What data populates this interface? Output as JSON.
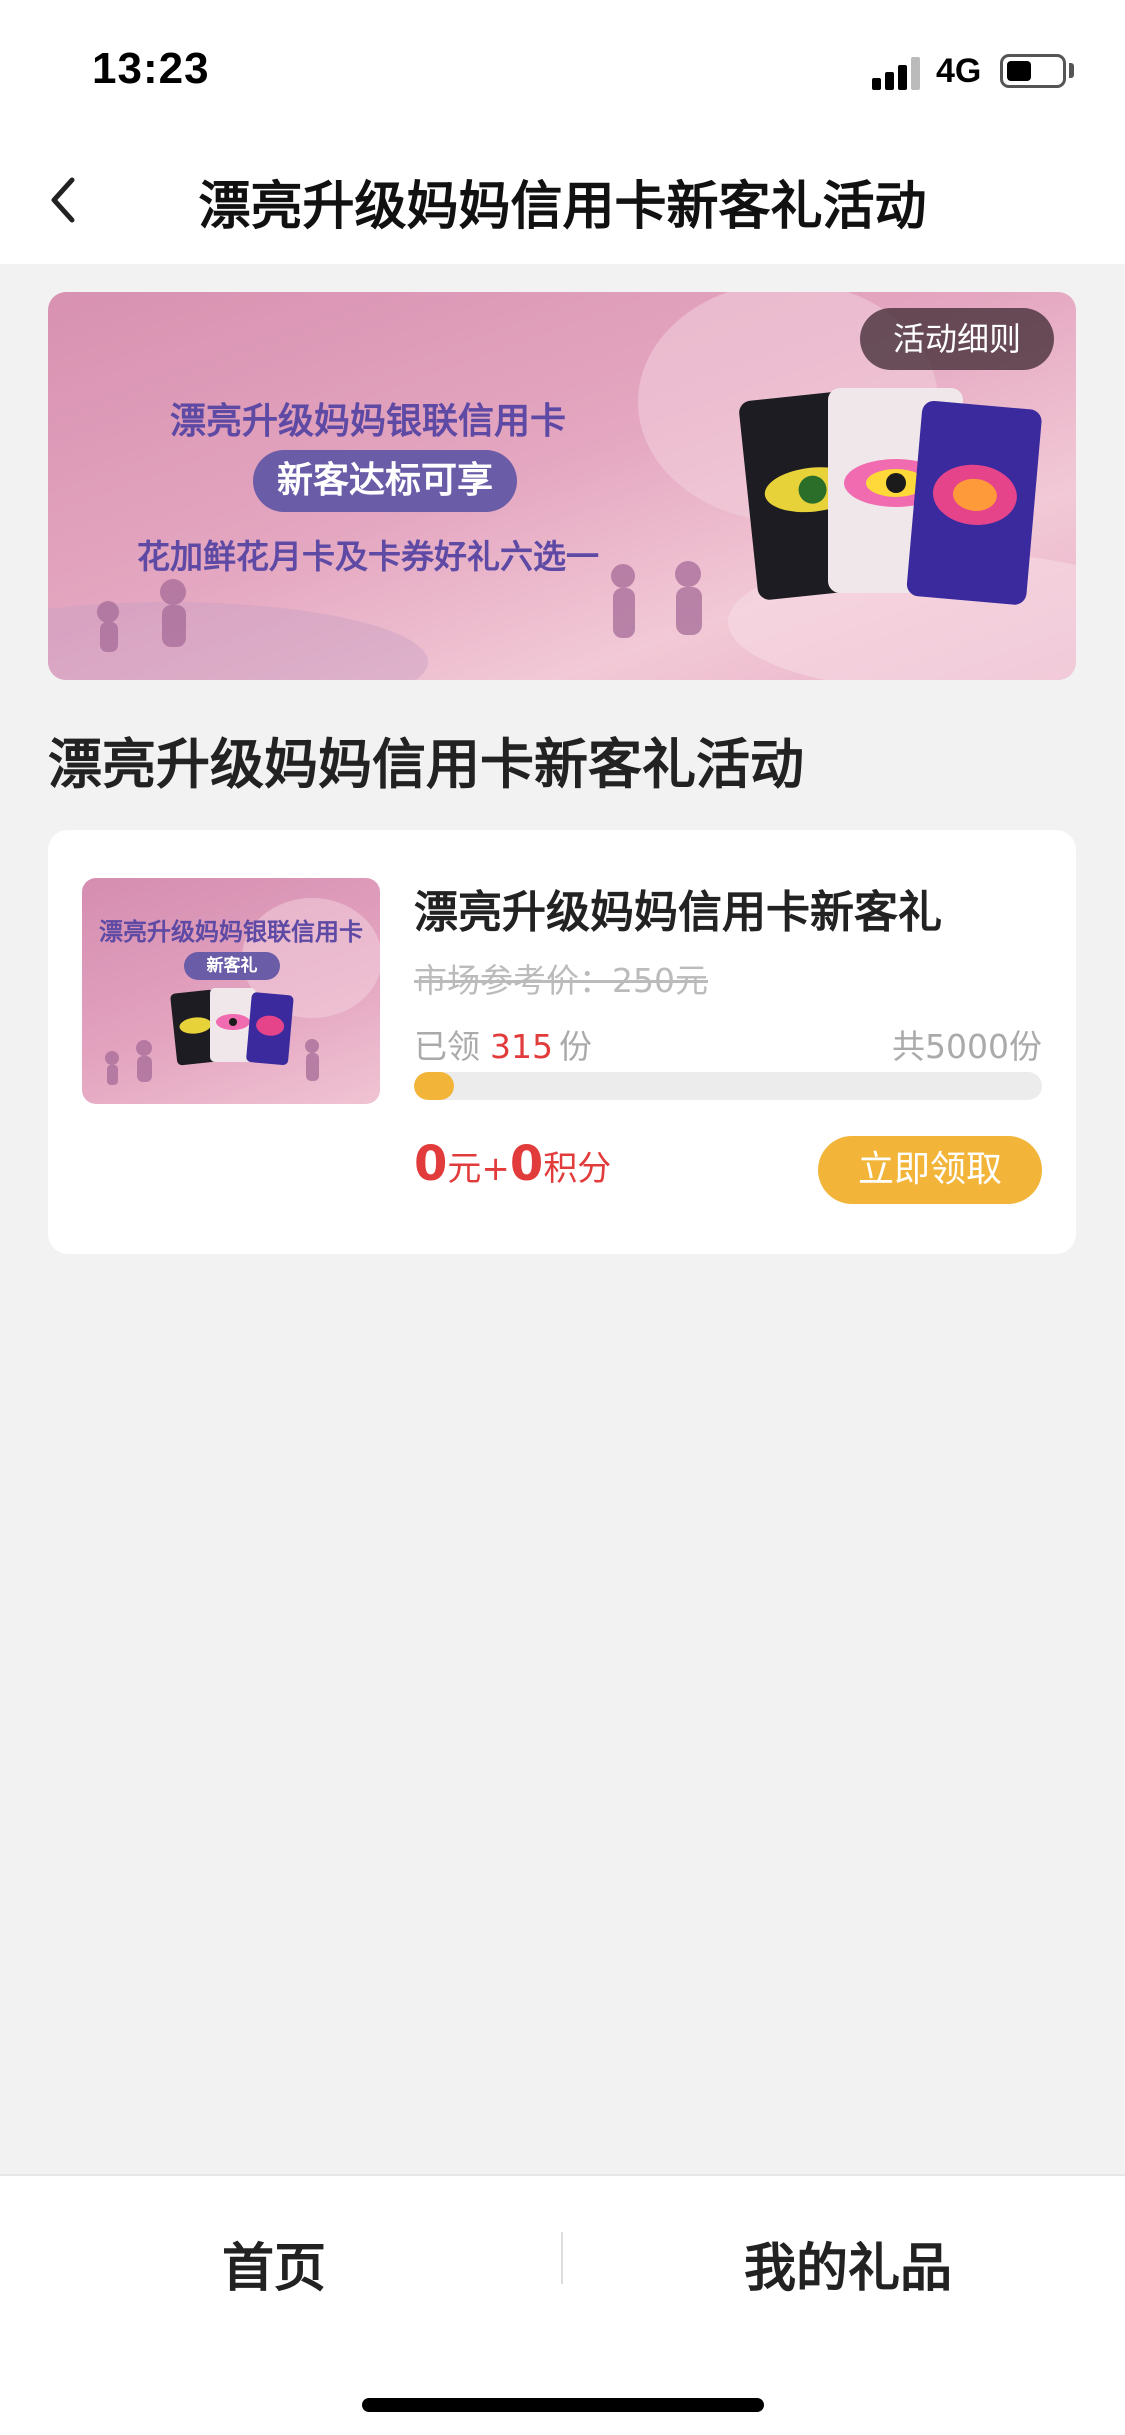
{
  "status_bar": {
    "time": "13:23",
    "network": "4G",
    "signal_icon": "signal-bars-icon",
    "battery_icon": "battery-icon"
  },
  "nav": {
    "title": "漂亮升级妈妈信用卡新客礼活动",
    "back_icon": "chevron-left-icon"
  },
  "banner": {
    "line1": "漂亮升级妈妈银联信用卡",
    "pill": "新客达标可享",
    "line3": "花加鲜花月卡及卡券好礼六选一",
    "rules_button": "活动细则"
  },
  "section_title": "漂亮升级妈妈信用卡新客礼活动",
  "gift": {
    "thumb_line1": "漂亮升级妈妈银联信用卡",
    "thumb_pill": "新客礼",
    "title": "漂亮升级妈妈信用卡新客礼",
    "market_price": "市场参考价：250元",
    "claimed_prefix": "已领",
    "claimed_count": "315",
    "claimed_suffix": "份",
    "total": "共5000份",
    "progress_fraction": 0.063,
    "price_amount": "0",
    "price_unit": "元+",
    "points_amount": "0",
    "points_unit": "积分",
    "claim_button": "立即领取"
  },
  "tab_bar": {
    "home": "首页",
    "my_gifts": "我的礼品"
  },
  "colors": {
    "accent": "#f2b53a",
    "price_red": "#e23b3b",
    "banner_pink": "#e4a6c0",
    "banner_purple": "#6b5ca8"
  }
}
